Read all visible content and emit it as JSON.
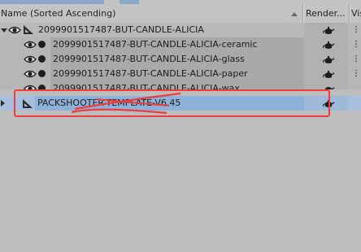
{
  "header": {
    "name_column": "Name (Sorted Ascending)",
    "render_column": "Render...",
    "visibility_column": "Visi",
    "accent_color": "#8eb1d9"
  },
  "rows": [
    {
      "label": "2099901517487-BUT-CANDLE-ALICIA",
      "type": "group",
      "expanded": true
    },
    {
      "label": "2099901517487-BUT-CANDLE-ALICIA-ceramic",
      "type": "child"
    },
    {
      "label": "2099901517487-BUT-CANDLE-ALICIA-glass",
      "type": "child"
    },
    {
      "label": "2099901517487-BUT-CANDLE-ALICIA-paper",
      "type": "child"
    },
    {
      "label": "2099901517487-BUT-CANDLE-ALICIA-wax",
      "type": "child"
    },
    {
      "label": "PACKSHOOTER-TEMPLATE-V6.45",
      "type": "group",
      "selected": true,
      "expanded": false
    }
  ],
  "annotation": {
    "highlight_color": "#f03c3c"
  }
}
